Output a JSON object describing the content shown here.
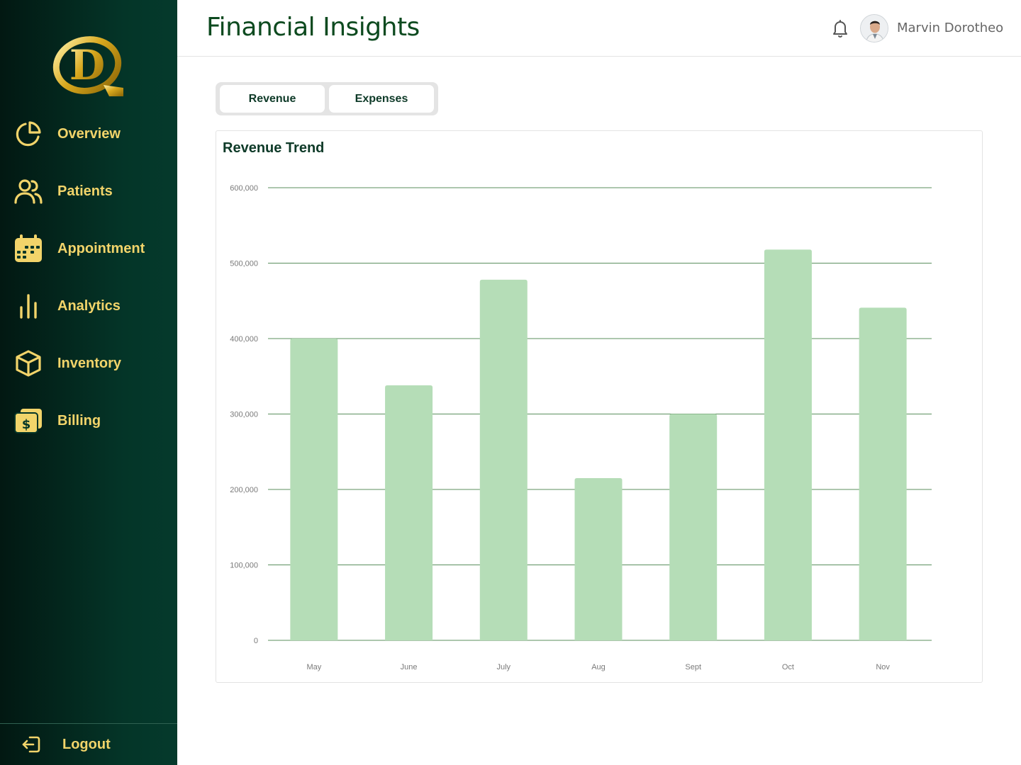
{
  "app": {
    "logo_letter": "D"
  },
  "sidebar": {
    "items": [
      {
        "label": "Overview",
        "icon": "pie-chart-icon"
      },
      {
        "label": "Patients",
        "icon": "users-icon"
      },
      {
        "label": "Appointment",
        "icon": "calendar-icon"
      },
      {
        "label": "Analytics",
        "icon": "bar-chart-icon"
      },
      {
        "label": "Inventory",
        "icon": "box-icon"
      },
      {
        "label": "Billing",
        "icon": "billing-icon"
      }
    ],
    "logout_label": "Logout"
  },
  "header": {
    "title": "Financial Insights",
    "user_name": "Marvin Dorotheo"
  },
  "tabs": [
    {
      "label": "Revenue"
    },
    {
      "label": "Expenses"
    }
  ],
  "colors": {
    "sidebar_accent": "#f2d46a",
    "bar_fill": "#b5ddb7",
    "grid_line": "#5b8f5e",
    "title_green": "#0d4a1f"
  },
  "chart_data": {
    "type": "bar",
    "title": "Revenue Trend",
    "categories": [
      "May",
      "June",
      "July",
      "Aug",
      "Sept",
      "Oct",
      "Nov"
    ],
    "values": [
      400000,
      338000,
      478000,
      215000,
      300000,
      518000,
      441000
    ],
    "ylim": [
      0,
      600000
    ],
    "yticks": [
      0,
      100000,
      200000,
      300000,
      400000,
      500000,
      600000
    ],
    "ytick_labels": [
      "0",
      "100,000",
      "200,000",
      "300,000",
      "400,000",
      "500,000",
      "600,000"
    ],
    "grid": true,
    "xlabel": "",
    "ylabel": ""
  }
}
